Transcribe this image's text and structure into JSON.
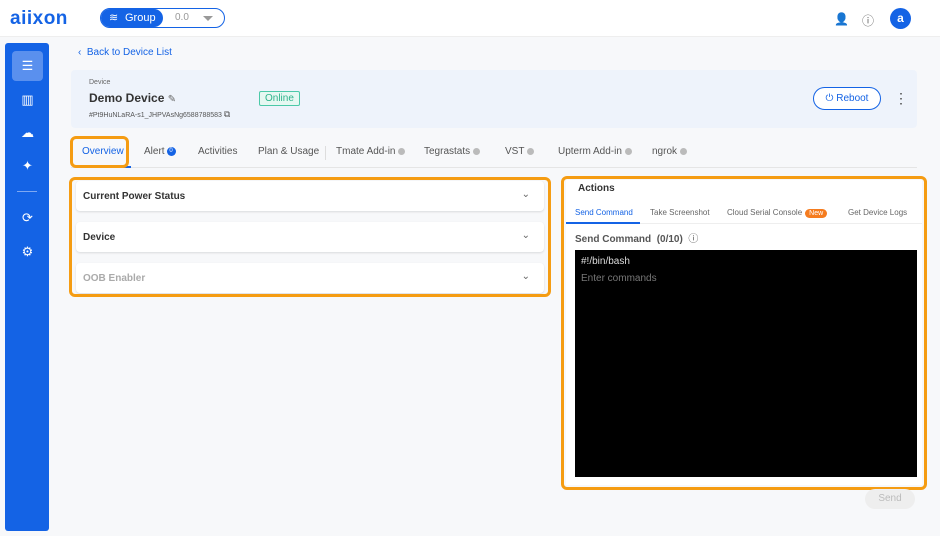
{
  "header": {
    "logo": "aiixon",
    "group_label": "Group",
    "version": "0.0",
    "avatar": "a"
  },
  "back_link": "Back to Device List",
  "device": {
    "label": "Device",
    "name": "Demo Device",
    "id": "#Pt9HuNLaRA-s1_JHPVAsNg6588788583",
    "status": "Online",
    "reboot": "Reboot"
  },
  "tabs": [
    {
      "label": "Overview"
    },
    {
      "label": "Alert",
      "badge": "0"
    },
    {
      "label": "Activities"
    },
    {
      "label": "Plan & Usage"
    },
    {
      "label": "Tmate Add-in"
    },
    {
      "label": "Tegrastats"
    },
    {
      "label": "VST"
    },
    {
      "label": "Upterm Add-in"
    },
    {
      "label": "ngrok"
    }
  ],
  "panels": [
    "Current Power Status",
    "Device",
    "OOB Enabler"
  ],
  "actions": {
    "title": "Actions",
    "tabs": [
      "Send Command",
      "Take Screenshot",
      "Cloud Serial Console",
      "Get Device Logs"
    ],
    "new_badge": "New",
    "section": "Send Command",
    "count": "(0/10)",
    "shebang": "#!/bin/bash",
    "placeholder": "Enter commands",
    "send": "Send"
  }
}
